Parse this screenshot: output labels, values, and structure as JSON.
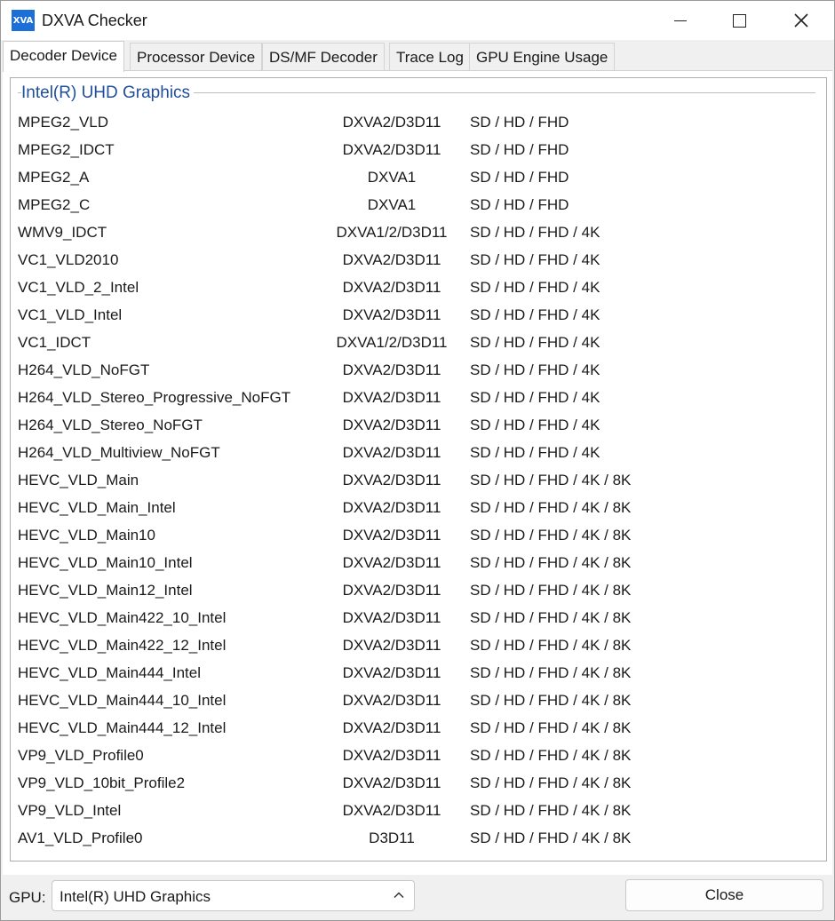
{
  "window": {
    "title": "DXVA Checker",
    "icon_text": "XVA"
  },
  "tabs": [
    {
      "label": "Decoder Device",
      "active": true
    },
    {
      "label": "Processor Device"
    },
    {
      "label": "DS/MF Decoder"
    },
    {
      "label": "Trace Log"
    },
    {
      "label": "GPU Engine Usage"
    }
  ],
  "group": {
    "title": "Intel(R) UHD Graphics"
  },
  "decoders": [
    {
      "name": "MPEG2_VLD",
      "api": "DXVA2/D3D11",
      "res": "SD / HD / FHD"
    },
    {
      "name": "MPEG2_IDCT",
      "api": "DXVA2/D3D11",
      "res": "SD / HD / FHD"
    },
    {
      "name": "MPEG2_A",
      "api": "DXVA1",
      "res": "SD / HD / FHD"
    },
    {
      "name": "MPEG2_C",
      "api": "DXVA1",
      "res": "SD / HD / FHD"
    },
    {
      "name": "WMV9_IDCT",
      "api": "DXVA1/2/D3D11",
      "res": "SD / HD / FHD / 4K"
    },
    {
      "name": "VC1_VLD2010",
      "api": "DXVA2/D3D11",
      "res": "SD / HD / FHD / 4K"
    },
    {
      "name": "VC1_VLD_2_Intel",
      "api": "DXVA2/D3D11",
      "res": "SD / HD / FHD / 4K"
    },
    {
      "name": "VC1_VLD_Intel",
      "api": "DXVA2/D3D11",
      "res": "SD / HD / FHD / 4K"
    },
    {
      "name": "VC1_IDCT",
      "api": "DXVA1/2/D3D11",
      "res": "SD / HD / FHD / 4K"
    },
    {
      "name": "H264_VLD_NoFGT",
      "api": "DXVA2/D3D11",
      "res": "SD / HD / FHD / 4K"
    },
    {
      "name": "H264_VLD_Stereo_Progressive_NoFGT",
      "api": "DXVA2/D3D11",
      "res": "SD / HD / FHD / 4K"
    },
    {
      "name": "H264_VLD_Stereo_NoFGT",
      "api": "DXVA2/D3D11",
      "res": "SD / HD / FHD / 4K"
    },
    {
      "name": "H264_VLD_Multiview_NoFGT",
      "api": "DXVA2/D3D11",
      "res": "SD / HD / FHD / 4K"
    },
    {
      "name": "HEVC_VLD_Main",
      "api": "DXVA2/D3D11",
      "res": "SD / HD / FHD / 4K / 8K"
    },
    {
      "name": "HEVC_VLD_Main_Intel",
      "api": "DXVA2/D3D11",
      "res": "SD / HD / FHD / 4K / 8K"
    },
    {
      "name": "HEVC_VLD_Main10",
      "api": "DXVA2/D3D11",
      "res": "SD / HD / FHD / 4K / 8K"
    },
    {
      "name": "HEVC_VLD_Main10_Intel",
      "api": "DXVA2/D3D11",
      "res": "SD / HD / FHD / 4K / 8K"
    },
    {
      "name": "HEVC_VLD_Main12_Intel",
      "api": "DXVA2/D3D11",
      "res": "SD / HD / FHD / 4K / 8K"
    },
    {
      "name": "HEVC_VLD_Main422_10_Intel",
      "api": "DXVA2/D3D11",
      "res": "SD / HD / FHD / 4K / 8K"
    },
    {
      "name": "HEVC_VLD_Main422_12_Intel",
      "api": "DXVA2/D3D11",
      "res": "SD / HD / FHD / 4K / 8K"
    },
    {
      "name": "HEVC_VLD_Main444_Intel",
      "api": "DXVA2/D3D11",
      "res": "SD / HD / FHD / 4K / 8K"
    },
    {
      "name": "HEVC_VLD_Main444_10_Intel",
      "api": "DXVA2/D3D11",
      "res": "SD / HD / FHD / 4K / 8K"
    },
    {
      "name": "HEVC_VLD_Main444_12_Intel",
      "api": "DXVA2/D3D11",
      "res": "SD / HD / FHD / 4K / 8K"
    },
    {
      "name": "VP9_VLD_Profile0",
      "api": "DXVA2/D3D11",
      "res": "SD / HD / FHD / 4K / 8K"
    },
    {
      "name": "VP9_VLD_10bit_Profile2",
      "api": "DXVA2/D3D11",
      "res": "SD / HD / FHD / 4K / 8K"
    },
    {
      "name": "VP9_VLD_Intel",
      "api": "DXVA2/D3D11",
      "res": "SD / HD / FHD / 4K / 8K"
    },
    {
      "name": "AV1_VLD_Profile0",
      "api": "D3D11",
      "res": "SD / HD / FHD / 4K / 8K"
    }
  ],
  "footer": {
    "gpu_label": "GPU:",
    "gpu_value": "Intel(R) UHD Graphics",
    "close_label": "Close"
  },
  "colors": {
    "group_title": "#1f4e9c",
    "app_icon": "#1c6fd8"
  },
  "icons": {
    "app": "dxva-app-icon",
    "minimize": "minimize-icon",
    "maximize": "maximize-icon",
    "close": "close-icon",
    "select": "chevron-up-icon"
  }
}
